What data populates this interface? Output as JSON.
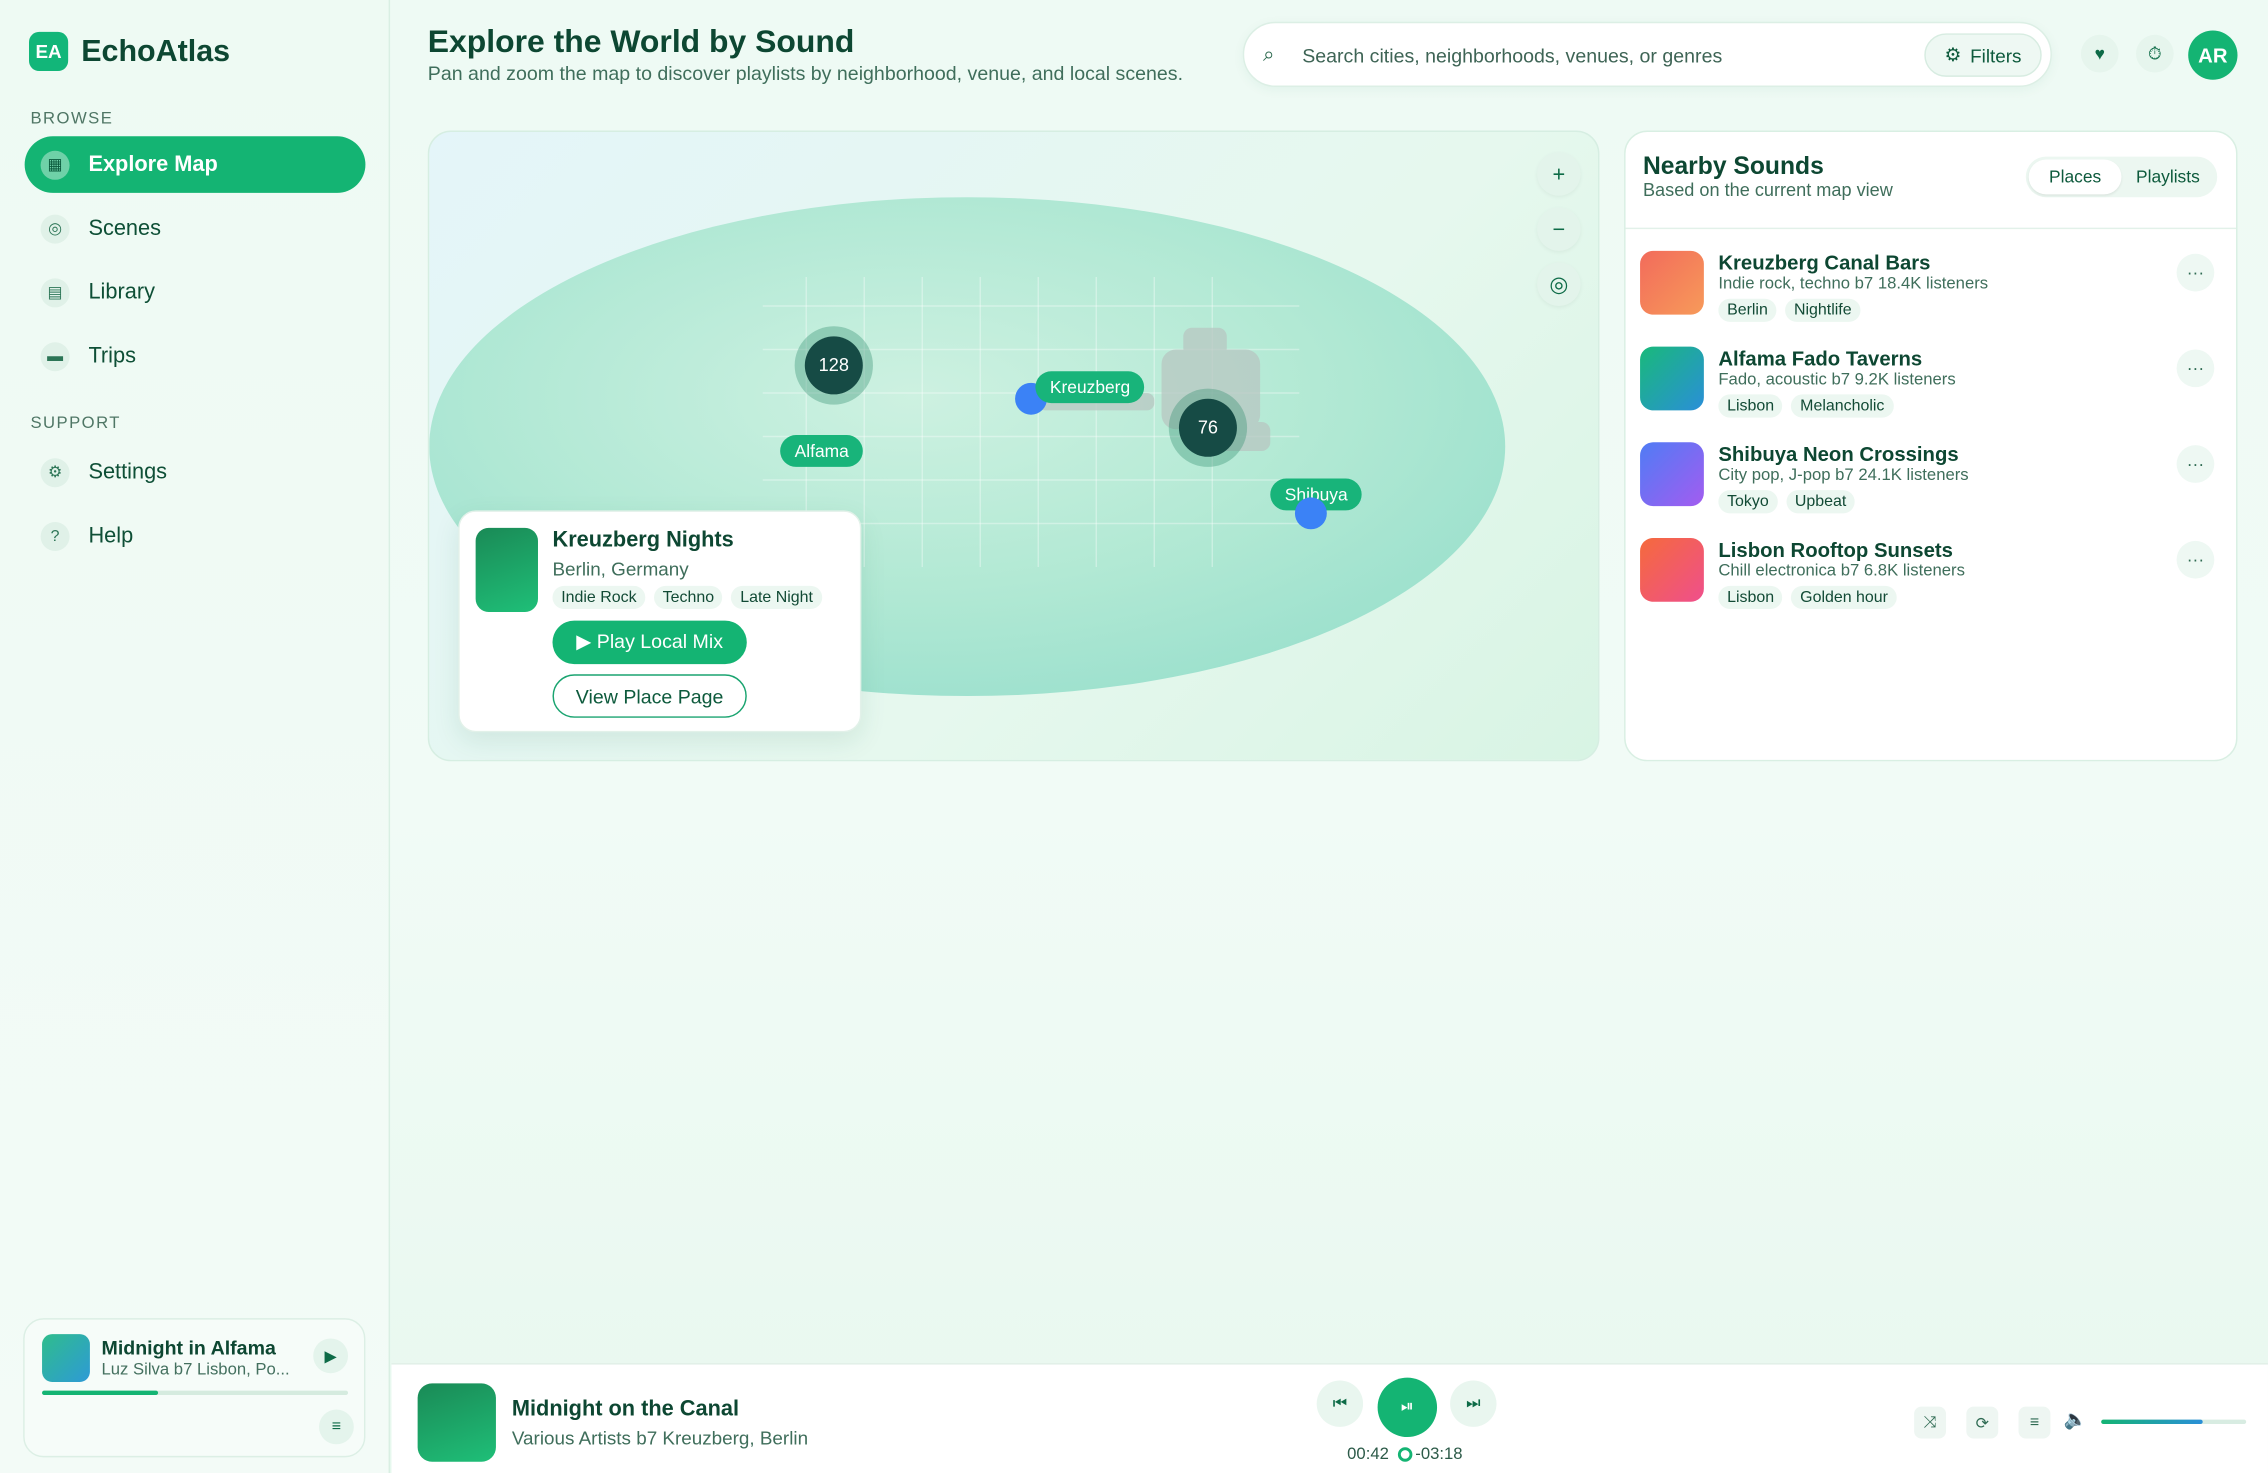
{
  "app": {
    "logo": "EA",
    "name": "EchoAtlas"
  },
  "sidebar": {
    "browse_label": "BROWSE",
    "browse": [
      {
        "label": "Explore Map",
        "icon": "map-icon",
        "glyph": "▦",
        "active": true
      },
      {
        "label": "Scenes",
        "icon": "compass-icon",
        "glyph": "◎"
      },
      {
        "label": "Library",
        "icon": "books-icon",
        "glyph": "▤"
      },
      {
        "label": "Trips",
        "icon": "car-icon",
        "glyph": "▬"
      }
    ],
    "support_label": "SUPPORT",
    "support": [
      {
        "label": "Settings",
        "icon": "gear-icon",
        "glyph": "⚙"
      },
      {
        "label": "Help",
        "icon": "help-icon",
        "glyph": "?"
      }
    ],
    "mini_player": {
      "title": "Midnight in Alfama",
      "subtitle": "Luz Silva b7 Lisbon, Po...",
      "progress": 0.38,
      "play_glyph": "▶",
      "queue_glyph": "≡"
    }
  },
  "header": {
    "title": "Explore the World by Sound",
    "subtitle": "Pan and zoom the map to discover playlists by neighborhood, venue, and local scenes.",
    "search_placeholder": "Search cities, neighborhoods, venues, or genres",
    "filters_label": "Filters",
    "favorite_glyph": "♥",
    "timer_glyph": "⏱",
    "avatar_initials": "AR"
  },
  "map": {
    "zoom_in": "+",
    "zoom_out": "−",
    "compass_glyph": "◎",
    "clusters": [
      {
        "count": "128"
      },
      {
        "count": "76"
      }
    ],
    "pins": [
      {
        "label": "Kreuzberg"
      },
      {
        "label": "Alfama"
      },
      {
        "label": "Shibuya"
      }
    ],
    "place_card": {
      "title": "Kreuzberg Nights",
      "location": "Berlin, Germany",
      "tags": [
        "Indie Rock",
        "Techno",
        "Late Night"
      ],
      "play_label": "▶ Play Local Mix",
      "view_label": "View Place Page"
    }
  },
  "nearby": {
    "title": "Nearby Sounds",
    "subtitle": "Based on the current map view",
    "tabs": [
      {
        "label": "Places",
        "active": true
      },
      {
        "label": "Playlists"
      }
    ],
    "more_glyph": "···",
    "items": [
      {
        "title": "Kreuzberg Canal Bars",
        "subtitle": "Indie rock, techno b7 18.4K listeners",
        "tags": [
          "Berlin",
          "Nightlife"
        ],
        "colors": [
          "#f26b5b",
          "#f79a5a"
        ]
      },
      {
        "title": "Alfama Fado Taverns",
        "subtitle": "Fado, acoustic b7 9.2K listeners",
        "tags": [
          "Lisbon",
          "Melancholic"
        ],
        "colors": [
          "#19b97a",
          "#2a8fd8"
        ]
      },
      {
        "title": "Shibuya Neon Crossings",
        "subtitle": "City pop, J-pop b7 24.1K listeners",
        "tags": [
          "Tokyo",
          "Upbeat"
        ],
        "colors": [
          "#4f7cf5",
          "#a35cf0"
        ]
      },
      {
        "title": "Lisbon Rooftop Sunsets",
        "subtitle": "Chill electronica b7 6.8K listeners",
        "tags": [
          "Lisbon",
          "Golden hour"
        ],
        "colors": [
          "#f56a3c",
          "#ef4f8c"
        ]
      }
    ]
  },
  "player": {
    "title": "Midnight on the Canal",
    "subtitle": "Various Artists b7 Kreuzberg, Berlin",
    "prev_glyph": "⏮",
    "play_pause_glyph": "⏯",
    "next_glyph": "⏭",
    "elapsed": "00:42",
    "duration": "-03:18",
    "tools": [
      "⤨",
      "⟳",
      "≡"
    ],
    "volume_glyph": "🔈",
    "volume": 0.7
  },
  "colors": {
    "accent": "#14b473",
    "dark": "#0d4732"
  }
}
